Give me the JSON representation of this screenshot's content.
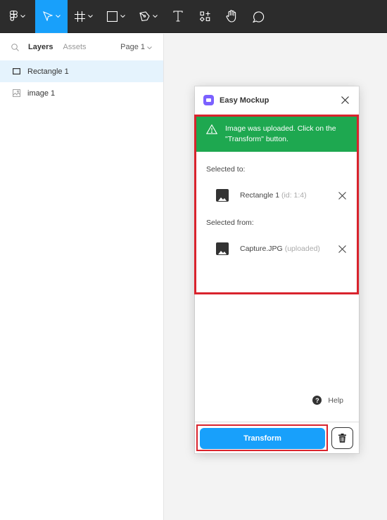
{
  "toolbar": {
    "tools": [
      {
        "name": "main-menu",
        "icon": "figma-logo-icon",
        "active": false
      },
      {
        "name": "move",
        "icon": "move-cursor-icon",
        "active": true
      },
      {
        "name": "frame",
        "icon": "frame-icon",
        "active": false
      },
      {
        "name": "shape",
        "icon": "rectangle-icon",
        "active": false
      },
      {
        "name": "pen",
        "icon": "pen-icon",
        "active": false
      },
      {
        "name": "text",
        "icon": "text-icon",
        "active": false
      },
      {
        "name": "components",
        "icon": "components-icon",
        "active": false
      },
      {
        "name": "hand",
        "icon": "hand-icon",
        "active": false
      },
      {
        "name": "comment",
        "icon": "comment-icon",
        "active": false
      }
    ],
    "active_color": "#18a0fb"
  },
  "left_panel": {
    "tabs": {
      "layers": "Layers",
      "assets": "Assets"
    },
    "page_selector": "Page 1",
    "layers": [
      {
        "label": "Rectangle 1",
        "icon": "rectangle-icon",
        "selected": true
      },
      {
        "label": "image 1",
        "icon": "image-icon",
        "selected": false
      }
    ]
  },
  "plugin": {
    "title": "Easy Mockup",
    "banner": {
      "message": "Image was uploaded. Click on the \"Transform\" button.",
      "color": "#1ea850"
    },
    "selected_to": {
      "label": "Selected to:",
      "name": "Rectangle 1",
      "meta": "(id: 1:4)"
    },
    "selected_from": {
      "label": "Selected from:",
      "name": "Capture.JPG",
      "meta": "(uploaded)"
    },
    "help_label": "Help",
    "transform_label": "Transform",
    "highlight_color": "#d9232d"
  }
}
